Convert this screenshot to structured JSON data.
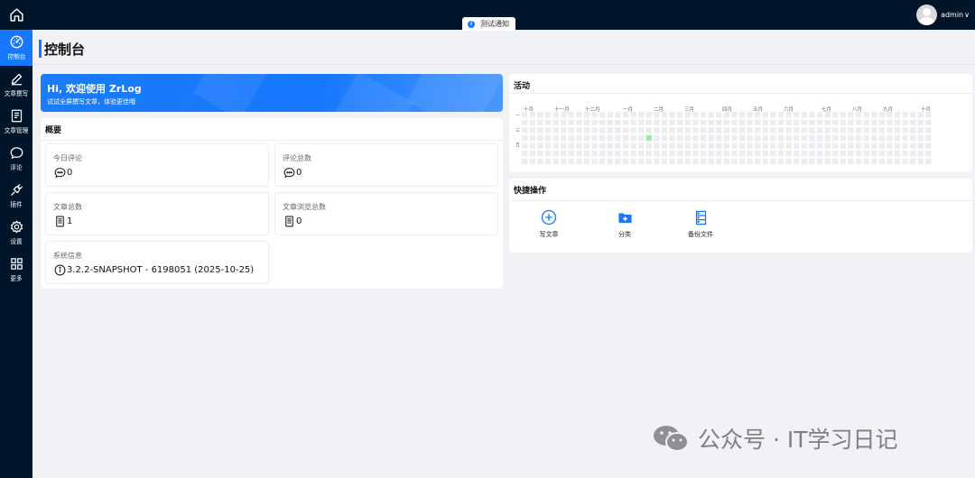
{
  "header": {
    "notice": "测试通知",
    "username": "admin",
    "caret": "∨"
  },
  "sidebar": {
    "items": [
      {
        "label": "控制台",
        "icon": "dashboard-icon",
        "active": true
      },
      {
        "label": "文章撰写",
        "icon": "pen-icon"
      },
      {
        "label": "文章管理",
        "icon": "document-icon"
      },
      {
        "label": "评论",
        "icon": "comment-icon"
      },
      {
        "label": "插件",
        "icon": "plugin-icon"
      },
      {
        "label": "设置",
        "icon": "gear-icon"
      },
      {
        "label": "更多",
        "icon": "grid-icon"
      }
    ]
  },
  "page": {
    "title": "控制台"
  },
  "banner": {
    "title": "Hi, 欢迎使用 ZrLog",
    "subtitle": "试试全屏撰写文章，体验更佳哦"
  },
  "overview": {
    "title": "概要",
    "stats": [
      {
        "label": "今日评论",
        "value": "0",
        "icon": "comment-icon"
      },
      {
        "label": "评论总数",
        "value": "0",
        "icon": "comment-icon"
      },
      {
        "label": "文章总数",
        "value": "1",
        "icon": "article-icon"
      },
      {
        "label": "文章浏览总数",
        "value": "0",
        "icon": "article-icon"
      },
      {
        "label": "系统信息",
        "value": "3.2.2-SNAPSHOT - 6198051 (2025-10-25)",
        "icon": "info-icon"
      }
    ]
  },
  "activity": {
    "title": "活动",
    "months": [
      "十月",
      "十一月",
      "十二月",
      "一月",
      "二月",
      "三月",
      "四月",
      "五月",
      "六月",
      "七月",
      "八月",
      "九月",
      "十月"
    ],
    "day_labels": [
      "一",
      "三",
      "五"
    ],
    "active_day": {
      "week": 16,
      "day": 3
    },
    "colors": {
      "empty": "#ebedf0",
      "active": "#9be9a8"
    }
  },
  "quick_actions": {
    "title": "快捷操作",
    "items": [
      {
        "label": "写文章",
        "icon": "plus-circle-icon"
      },
      {
        "label": "分类",
        "icon": "folder-add-icon"
      },
      {
        "label": "备份文件",
        "icon": "database-icon"
      }
    ]
  },
  "watermark": {
    "text": "公众号 · IT学习日记"
  },
  "colors": {
    "primary": "#1677ff",
    "nav_bg": "#001529"
  }
}
